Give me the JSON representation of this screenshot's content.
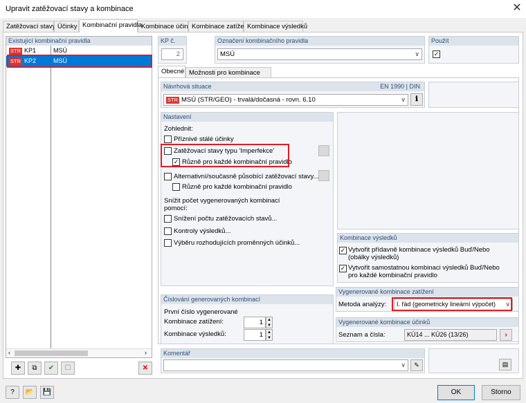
{
  "window": {
    "title": "Upravit zatěžovací stavy a kombinace"
  },
  "tabs": [
    "Zatěžovací stavy",
    "Účinky",
    "Kombinační pravidla",
    "Kombinace účinků",
    "Kombinace zatížení",
    "Kombinace výsledků"
  ],
  "rules": {
    "header": "Existující kombinační pravidla",
    "items": [
      {
        "badge": "STR",
        "id": "KP1",
        "name": "MSÚ"
      },
      {
        "badge": "STR",
        "id": "KP2",
        "name": "MSÚ"
      }
    ]
  },
  "kp": {
    "label": "KP č.",
    "value": "2"
  },
  "designation": {
    "label": "Označení kombinačního pravidla",
    "value": "MSÚ"
  },
  "use": {
    "label": "Použít"
  },
  "subtabs": [
    "Obecné",
    "Možnosti pro kombinace"
  ],
  "design_situation": {
    "label": "Návrhová situace",
    "standard": "EN 1990 | DIN",
    "badge": "STR",
    "value": "MSÚ (STR/GEO) - trvalá/dočasná - rovn. 6.10"
  },
  "settings": {
    "header": "Nastavení",
    "consider": "Zohlednit:",
    "favorable": "Příznivé stálé účinky",
    "imperfection": "Zatěžovací stavy typu 'Imperfekce'",
    "different1": "Různě pro každé kombinační pravidlo",
    "alternative": "Alternativní/současně působící zatěžovací stavy...",
    "different2": "Různě pro každé kombinační pravidlo",
    "reduce_label_1": "Snížit počet vygenerovaných kombinací",
    "reduce_label_2": "pomocí:",
    "reduce_lc": "Snížení počtu zatěžovacích stavů...",
    "checks": "Kontroly výsledků...",
    "selection": "Výběru rozhodujících proměnných účinků..."
  },
  "result_combos": {
    "header": "Kombinace výsledků",
    "opt1a": "Vytvořit přídavně kombinace výsledků Buď/Nebo",
    "opt1b": "(obálky výsledků)",
    "opt2a": "Vytvořit samostatnou kombinaci výsledků Buď/Nebo",
    "opt2b": "pro každé kombinační pravidlo"
  },
  "numbering": {
    "header": "Číslování generovaných kombinací",
    "first": "První číslo vygenerované",
    "lc_label": "Kombinace zatížení:",
    "lc_value": "1",
    "rc_label": "Kombinace výsledků:",
    "rc_value": "1"
  },
  "generated_lc": {
    "header": "Vygenerované kombinace zatížení",
    "method_label": "Metoda analýzy:",
    "method_value": "I. řád (geometricky lineární výpočet)"
  },
  "generated_ac": {
    "header": "Vygenerované kombinace účinků",
    "label": "Seznam a čísla:",
    "value": "KÚ14 ... KÚ26 (13/26)"
  },
  "comment": {
    "header": "Komentář"
  },
  "buttons": {
    "ok": "OK",
    "cancel": "Storno"
  },
  "colors": {
    "accent": "#0078d7",
    "highlight": "#e21b23",
    "badge": "#d33333",
    "header_bg": "#dde3ea"
  }
}
